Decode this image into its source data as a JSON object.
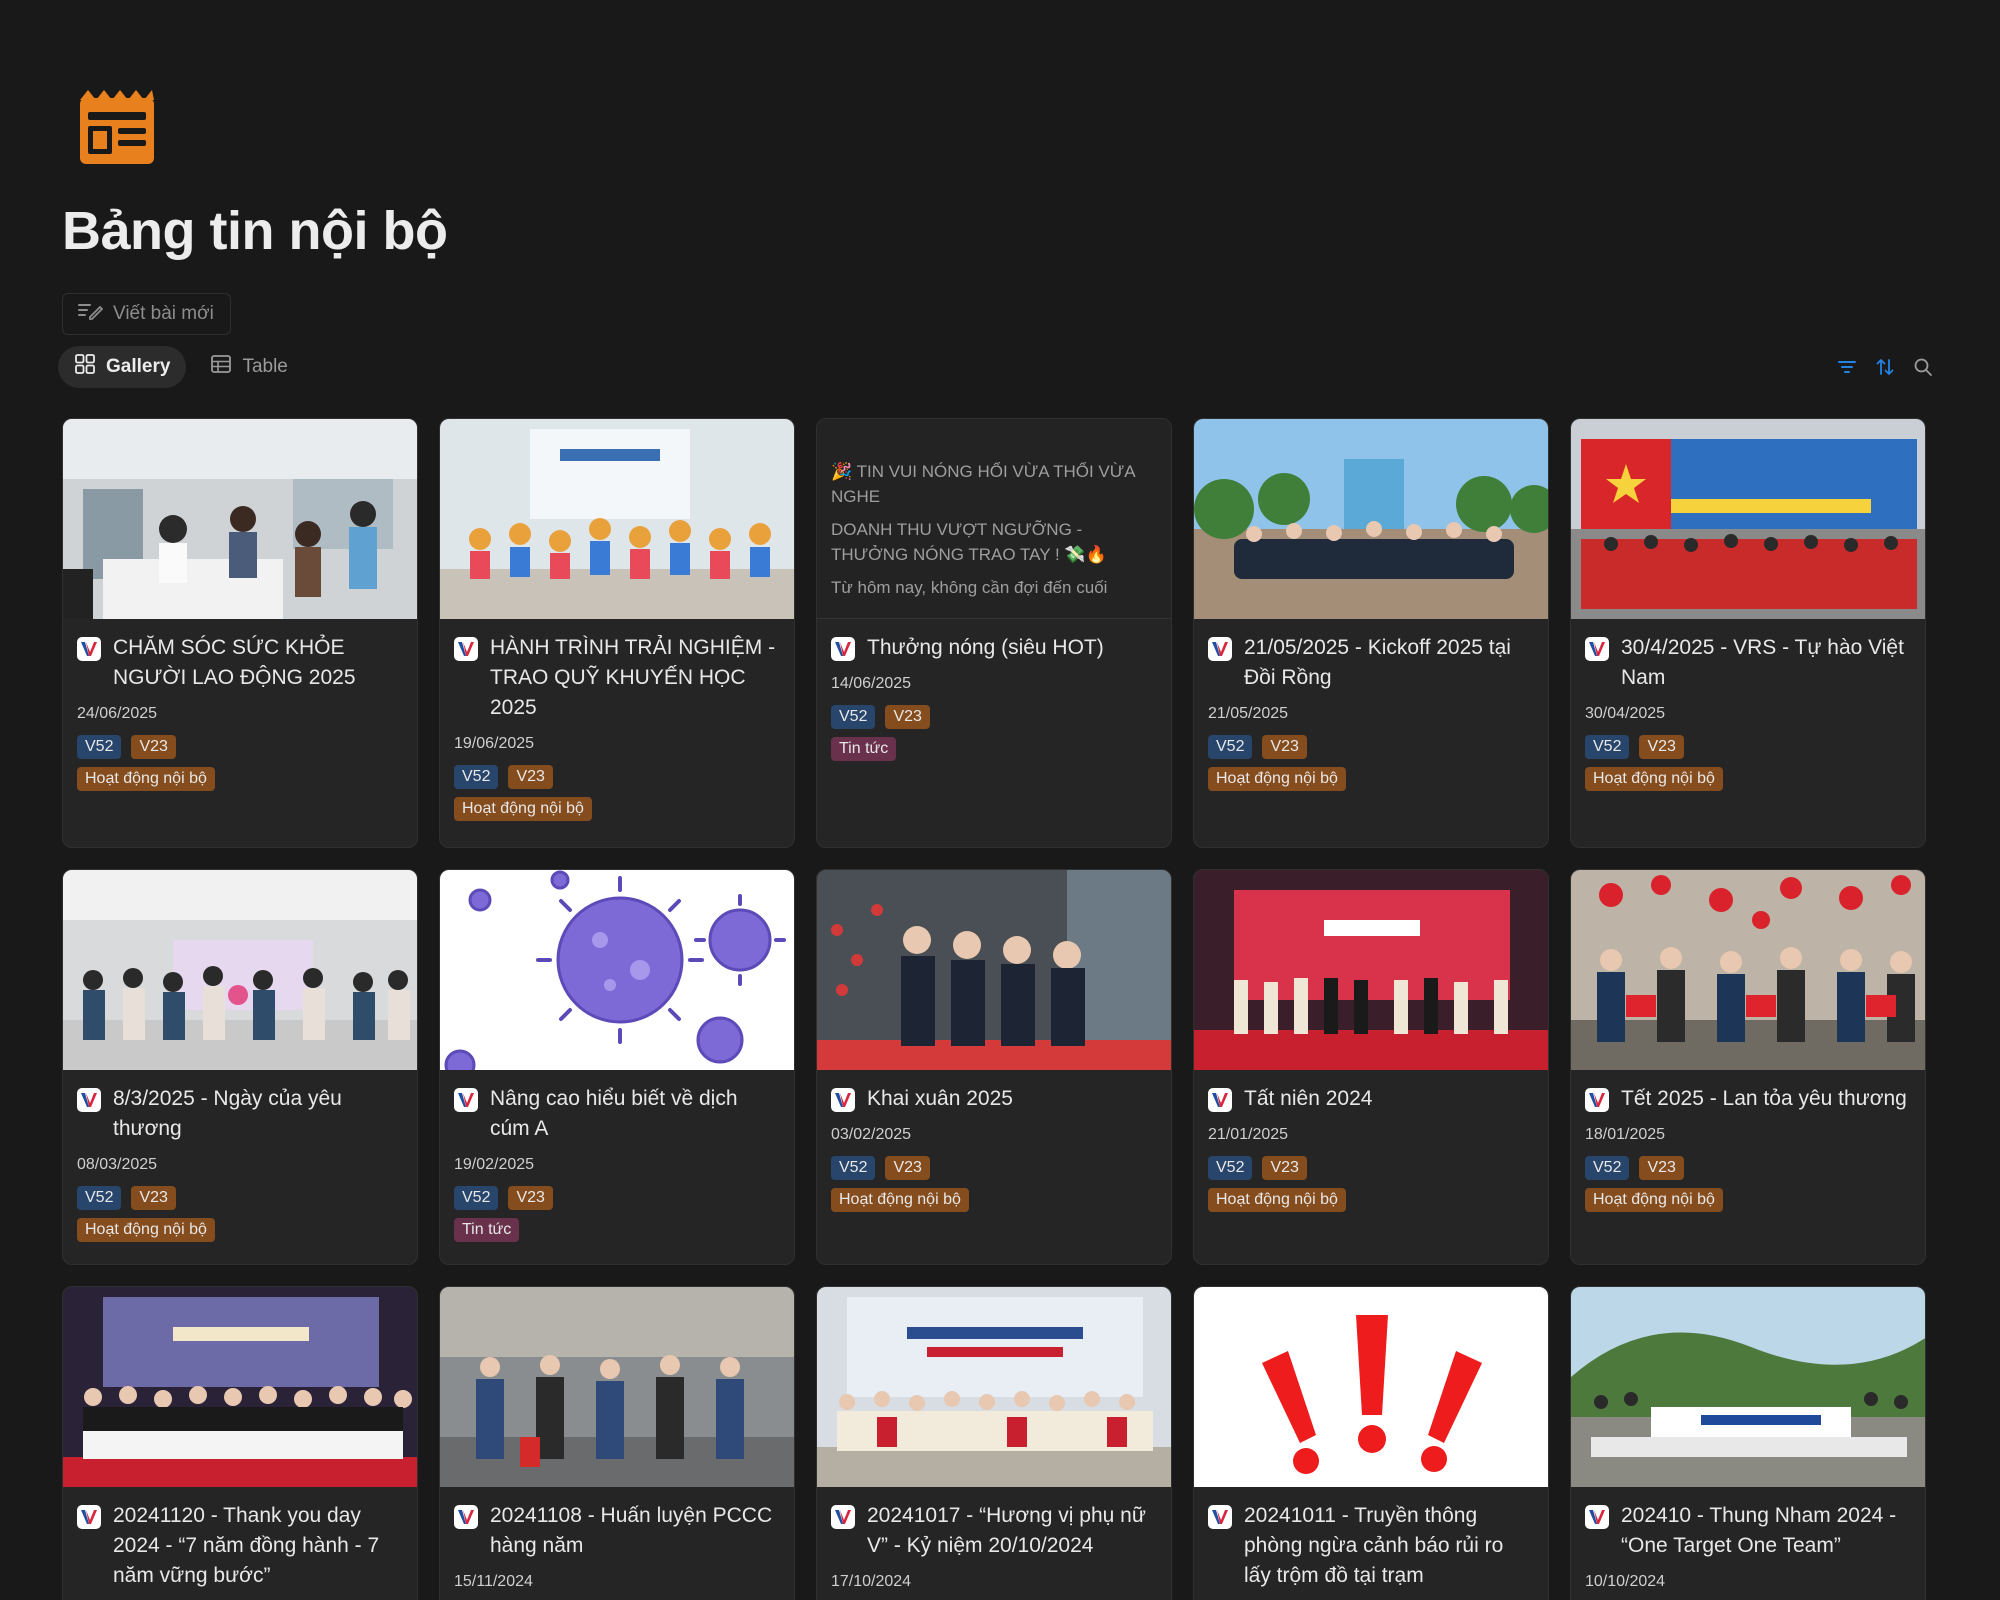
{
  "page": {
    "title": "Bảng tin nội bộ",
    "new_post_label": "Viết bài mới"
  },
  "views": [
    {
      "label": "Gallery",
      "icon": "gallery-icon",
      "active": true
    },
    {
      "label": "Table",
      "icon": "table-icon",
      "active": false
    }
  ],
  "toolbar": {
    "icons": [
      "filter-icon",
      "sort-icon",
      "search-icon"
    ],
    "accent": "#2383e2"
  },
  "colors": {
    "background": "#191919",
    "card": "#252525",
    "page_icon": "#e8811d",
    "tag_v52": "#28456c",
    "tag_v23": "#854c1d",
    "tag_hoat_dong": "#854c1d",
    "tag_tin_tuc": "#69314c"
  },
  "cards": [
    {
      "title": "CHĂM SÓC SỨC KHỎE NGƯỜI LAO ĐỘNG 2025",
      "date": "24/06/2025",
      "tags": [
        "V52",
        "V23"
      ],
      "category": "Hoạt động nội bộ",
      "cover": "photo-health-check"
    },
    {
      "title": "HÀNH TRÌNH TRẢI NGHIỆM - TRAO QUỸ KHUYẾN HỌC 2025",
      "date": "19/06/2025",
      "tags": [
        "V52",
        "V23"
      ],
      "category": "Hoạt động nội bộ",
      "cover": "photo-children-group"
    },
    {
      "title": "Thưởng nóng (siêu HOT)",
      "date": "14/06/2025",
      "tags": [
        "V52",
        "V23"
      ],
      "category": "Tin tức",
      "cover_text": [
        "🎉 TIN VUI NÓNG HỔI VỪA THỔI VỪA NGHE",
        "DOANH THU VƯỢT NGƯỠNG - THƯỞNG NÓNG TRAO TAY ! 💸🔥",
        "Từ hôm nay, không cần đợi đến cuối"
      ]
    },
    {
      "title": "21/05/2025 - Kickoff 2025 tại Đồi Rồng",
      "date": "21/05/2025",
      "tags": [
        "V52",
        "V23"
      ],
      "category": "Hoạt động nội bộ",
      "cover": "photo-resort-group"
    },
    {
      "title": "30/4/2025 - VRS - Tự hào Việt Nam",
      "date": "30/04/2025",
      "tags": [
        "V52",
        "V23"
      ],
      "category": "Hoạt động nội bộ",
      "cover": "photo-red-shirts-group"
    },
    {
      "title": "8/3/2025 - Ngày của yêu thương",
      "date": "08/03/2025",
      "tags": [
        "V52",
        "V23"
      ],
      "category": "Hoạt động nội bộ",
      "cover": "photo-office-women"
    },
    {
      "title": "Nâng cao hiểu biết về dịch cúm A",
      "date": "19/02/2025",
      "tags": [
        "V52",
        "V23"
      ],
      "category": "Tin tức",
      "cover": "virus-illustration"
    },
    {
      "title": "Khai xuân 2025",
      "date": "03/02/2025",
      "tags": [
        "V52",
        "V23"
      ],
      "category": "Hoạt động nội bộ",
      "cover": "photo-toast"
    },
    {
      "title": "Tất niên 2024",
      "date": "21/01/2025",
      "tags": [
        "V52",
        "V23"
      ],
      "category": "Hoạt động nội bộ",
      "cover": "photo-year-end-stage"
    },
    {
      "title": "Tết 2025 - Lan tỏa yêu thương",
      "date": "18/01/2025",
      "tags": [
        "V52",
        "V23"
      ],
      "category": "Hoạt động nội bộ",
      "cover": "photo-lanterns-gifts"
    },
    {
      "title": "20241120 - Thank you day 2024 - “7 năm đồng hành - 7 năm vững bước”",
      "date": "",
      "tags": [],
      "category": "",
      "cover": "photo-thank-you-day"
    },
    {
      "title": "20241108 - Huấn luyện PCCC hàng năm",
      "date": "15/11/2024",
      "tags": [],
      "category": "",
      "cover": "photo-fire-training"
    },
    {
      "title": "20241017 - “Hương vị phụ nữ V” - Kỷ niệm 20/10/2024",
      "date": "17/10/2024",
      "tags": [],
      "category": "",
      "cover": "photo-cooking-contest"
    },
    {
      "title": "20241011 - Truyền thông phòng ngừa cảnh báo rủi ro lấy trộm đồ tại trạm",
      "date": "",
      "tags": [],
      "category": "",
      "cover": "exclamation-marks"
    },
    {
      "title": "202410 - Thung Nham 2024 - “One Target One Team”",
      "date": "10/10/2024",
      "tags": [],
      "category": "",
      "cover": "photo-mountain-group"
    }
  ]
}
